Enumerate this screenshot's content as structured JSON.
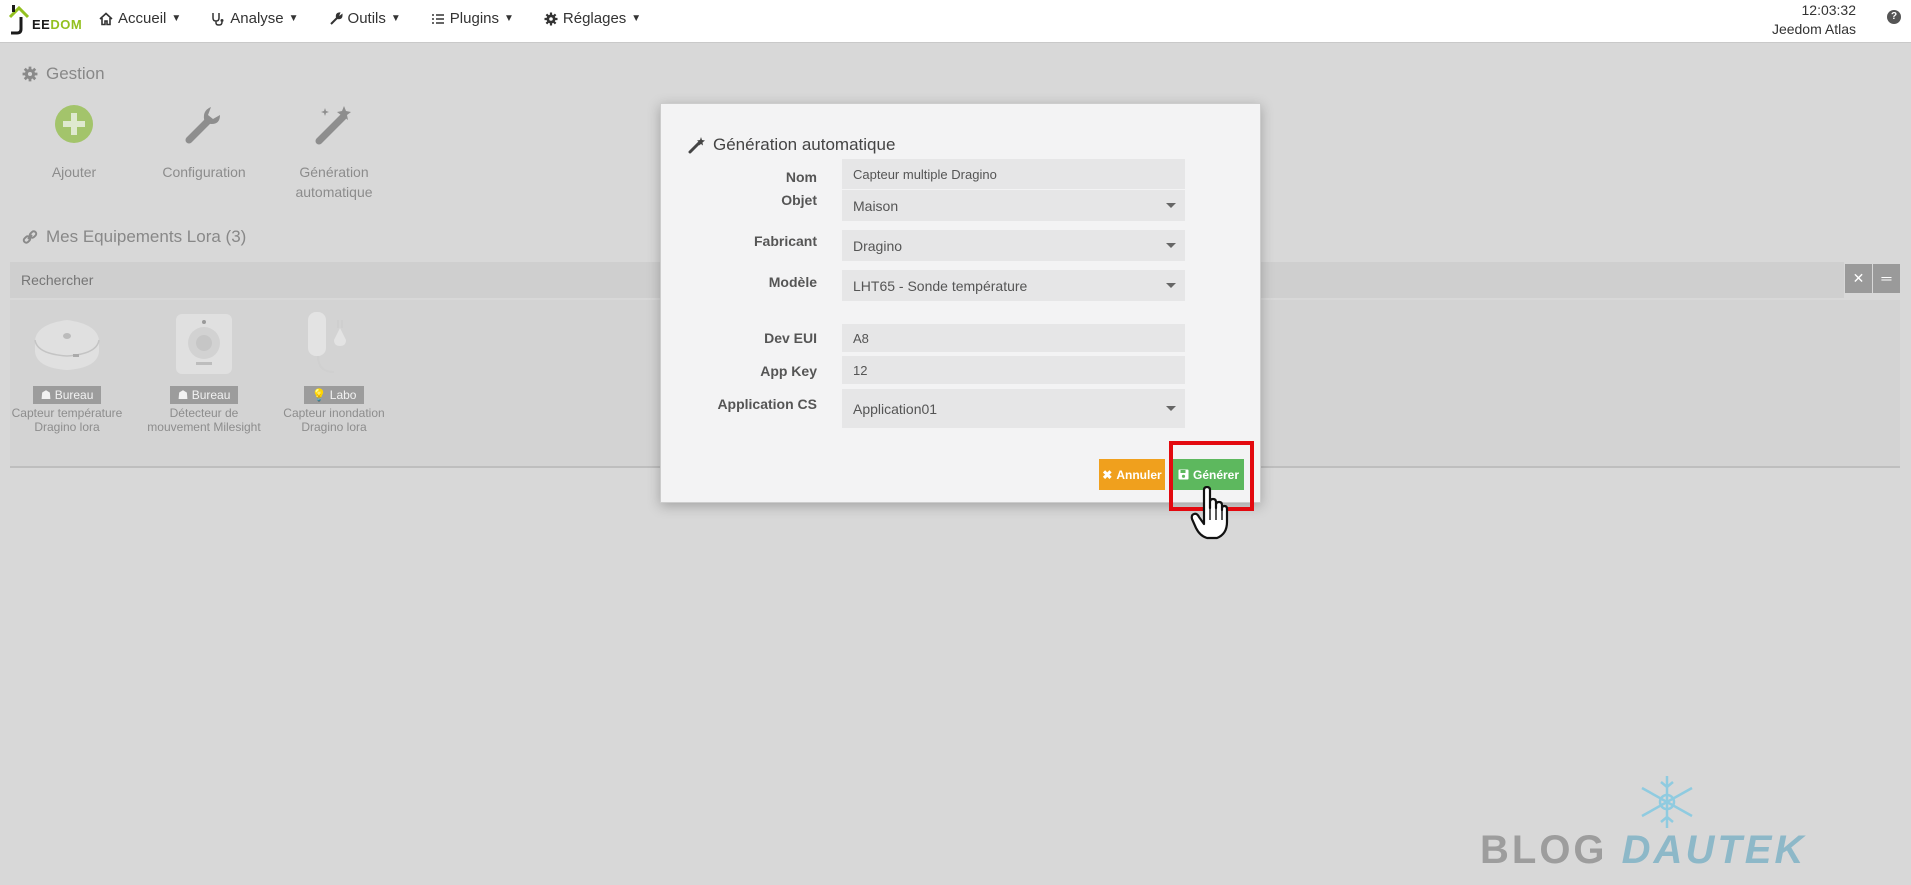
{
  "navbar": {
    "logo_text_a": "EE",
    "logo_text_b": "DOM",
    "logo_prefix": "J",
    "menu": [
      {
        "label": "Accueil",
        "icon": "home-icon"
      },
      {
        "label": "Analyse",
        "icon": "stethoscope-icon"
      },
      {
        "label": "Outils",
        "icon": "wrench-icon"
      },
      {
        "label": "Plugins",
        "icon": "list-icon"
      },
      {
        "label": "Réglages",
        "icon": "gear-icon"
      }
    ],
    "time": "12:03:32",
    "user": "Jeedom Atlas",
    "help_label": "?"
  },
  "gestion": {
    "title": "Gestion",
    "tiles": [
      {
        "label": "Ajouter",
        "icon": "plus-circle-icon"
      },
      {
        "label": "Configuration",
        "icon": "wrench-icon"
      },
      {
        "label_line1": "Génération",
        "label_line2": "automatique",
        "icon": "magic-wand-icon"
      }
    ]
  },
  "equipements": {
    "title": "Mes Equipements Lora (3)",
    "search_placeholder": "Rechercher",
    "clear_label": "✕",
    "sort_label": "═",
    "items": [
      {
        "room": "Bureau",
        "name_line1": "Capteur température",
        "name_line2": "Dragino lora"
      },
      {
        "room": "Bureau",
        "name_line1": "Détecteur de",
        "name_line2": "mouvement Milesight"
      },
      {
        "room": "Labo",
        "name_line1": "Capteur inondation",
        "name_line2": "Dragino lora"
      }
    ]
  },
  "modal": {
    "title": "Génération automatique",
    "fields": {
      "nom": {
        "label": "Nom",
        "value": "Capteur multiple Dragino"
      },
      "objet": {
        "label": "Objet",
        "value": "Maison"
      },
      "fabricant": {
        "label": "Fabricant",
        "value": "Dragino"
      },
      "modele": {
        "label": "Modèle",
        "value": "LHT65 - Sonde température"
      },
      "dev_eui": {
        "label": "Dev EUI",
        "value": "A8"
      },
      "app_key": {
        "label": "App Key",
        "value": "12"
      },
      "application_cs": {
        "label": "Application CS",
        "value": "Application01"
      }
    },
    "cancel_label": "Annuler",
    "generate_label": "Générer"
  },
  "watermark": {
    "text_a": "BLOG",
    "text_b": "DAUTEK"
  },
  "colors": {
    "accent_green": "#5db85e",
    "accent_orange": "#f0a01d",
    "highlight_red": "#e3090f",
    "logo_green": "#93c01f"
  }
}
